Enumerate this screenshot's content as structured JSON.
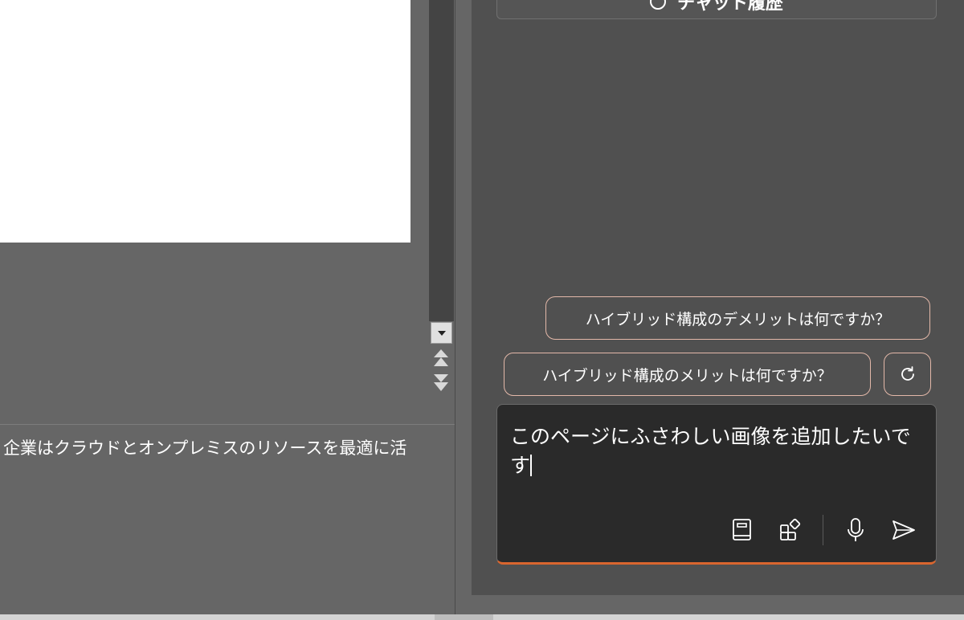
{
  "document": {
    "notes_text": "企業はクラウドとオンプレミスのリソースを最適に活"
  },
  "copilot": {
    "history_label": "チャット履歴",
    "suggestions": [
      {
        "label": "ハイブリッド構成のデメリットは何ですか？"
      },
      {
        "label": "ハイブリッド構成のメリットは何ですか？"
      }
    ],
    "composer": {
      "text": "このページにふさわしい画像を追加したいです"
    }
  },
  "colors": {
    "accent": "#d9662f",
    "chip_border": "#e3b8a9",
    "pane_bg": "#505050",
    "composer_bg": "#2a2a2a"
  },
  "icons": {
    "history": "clock-icon",
    "refresh": "refresh-icon",
    "notebook": "notebook-icon",
    "plugins": "plugins-icon",
    "mic": "microphone-icon",
    "send": "send-icon",
    "scroll_down": "triangle-down-icon",
    "prev_page": "double-chevron-up-icon",
    "next_page": "double-chevron-down-icon"
  }
}
